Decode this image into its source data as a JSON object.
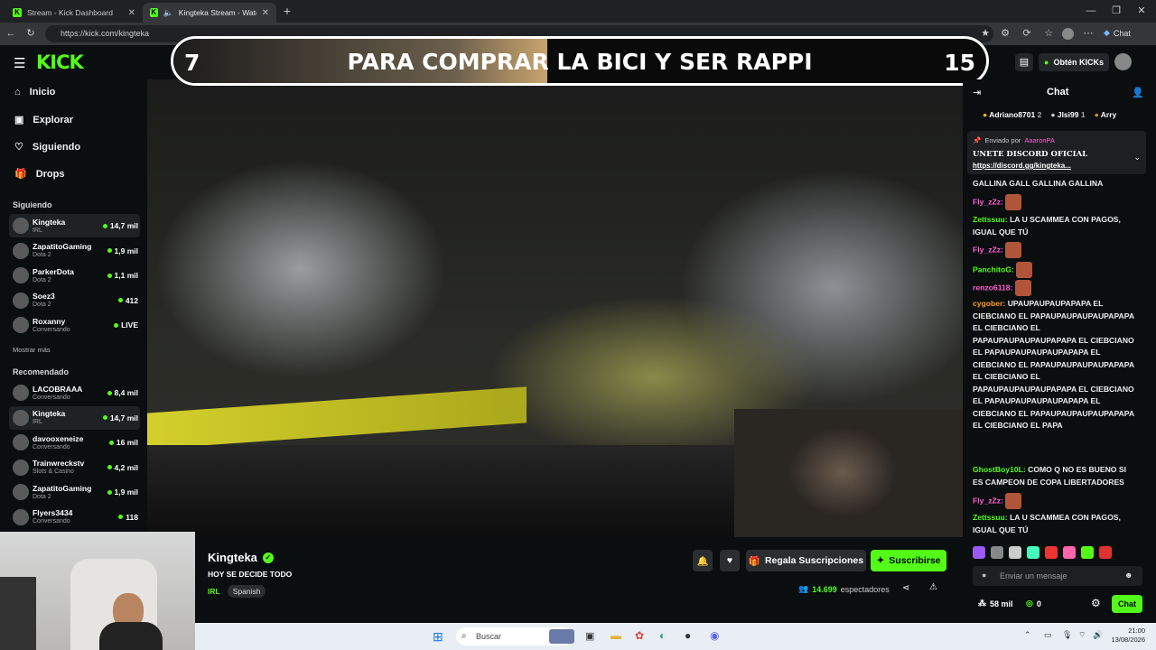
{
  "browser": {
    "tabs": [
      {
        "title": "Stream - Kick Dashboard",
        "active": false
      },
      {
        "title": "Kingteka Stream - Watch Live",
        "active": true
      }
    ],
    "url": "https://kick.com/kingteka",
    "toolbar_chat_label": "Chat"
  },
  "site": {
    "logo": "KICK",
    "get_kicks": "Obtén KICKs"
  },
  "nav": {
    "items": [
      {
        "label": "Inicio",
        "icon": "home-icon"
      },
      {
        "label": "Explorar",
        "icon": "browse-icon"
      },
      {
        "label": "Siguiendo",
        "icon": "heart-icon"
      },
      {
        "label": "Drops",
        "icon": "drops-icon"
      }
    ]
  },
  "following": {
    "title": "Siguiendo",
    "channels": [
      {
        "name": "Kingteka",
        "category": "IRL",
        "viewers": "14,7 mil"
      },
      {
        "name": "ZapatitoGaming",
        "category": "Dota 2",
        "viewers": "1,9 mil"
      },
      {
        "name": "ParkerDota",
        "category": "Dota 2",
        "viewers": "1,1 mil"
      },
      {
        "name": "Soez3",
        "category": "Dota 2",
        "viewers": "412"
      },
      {
        "name": "Roxanny",
        "category": "Conversando",
        "viewers": "LIVE"
      }
    ],
    "show_more": "Mostrar más"
  },
  "recommended": {
    "title": "Recomendado",
    "channels": [
      {
        "name": "LACOBRAAA",
        "category": "Conversando",
        "viewers": "8,4 mil"
      },
      {
        "name": "Kingteka",
        "category": "IRL",
        "viewers": "14,7 mil"
      },
      {
        "name": "davooxeneize",
        "category": "Conversando",
        "viewers": "16 mil"
      },
      {
        "name": "Trainwreckstv",
        "category": "Slots & Casino",
        "viewers": "4,2 mil"
      },
      {
        "name": "ZapatitoGaming",
        "category": "Dota 2",
        "viewers": "1,9 mil"
      },
      {
        "name": "Flyers3434",
        "category": "Conversando",
        "viewers": "118"
      }
    ]
  },
  "banner": {
    "left": "7",
    "text": "PARA COMPRAR LA BICI Y SER RAPPI",
    "right": "15",
    "progress": 0.46
  },
  "stream": {
    "channel": "Kingteka",
    "title": "HOY SE DECIDE TODO",
    "category": "IRL",
    "tag": "Spanish",
    "gift_label": "Regala Suscripciones",
    "subscribe_label": "Suscribirse",
    "viewers": "14.699",
    "viewers_label": "espectadores"
  },
  "chat": {
    "title": "Chat",
    "leaders": [
      {
        "name": "Adriano8701",
        "count": "2"
      },
      {
        "name": "Jlsi99",
        "count": "1"
      },
      {
        "name": "Arry",
        "count": ""
      }
    ],
    "pinned": {
      "sent_by": "Enviado por",
      "user": "AaaronPA",
      "line1": "UNETE DISCORD OFICIAL",
      "line2": "https://discord.gg/kingteka..."
    },
    "messages": [
      {
        "user": "",
        "text": "GALLINA GALL GALLINA GALLINA",
        "color": "#ffffff"
      },
      {
        "user": "Fly_zZz:",
        "text": "",
        "color": "#ff5fd2"
      },
      {
        "user": "Zettssuu:",
        "text": "LA U SCAMMEA CON PAGOS, IGUAL QUE TÚ",
        "color": "#53fc18"
      },
      {
        "user": "Fly_zZz:",
        "text": "",
        "color": "#ff5fd2"
      },
      {
        "user": "PanchitoG:",
        "text": "",
        "color": "#53fc18"
      },
      {
        "user": "renzo6118:",
        "text": "",
        "color": "#ff5fd2"
      },
      {
        "user": "cygober:",
        "text": "UPAUPAUPAUPAPAPA EL CIEBCIANO EL PAPAUPAUPAUPAUPAPAPA EL CIEBCIANO EL PAPAUPAUPAUPAUPAPAPA EL CIEBCIANO EL PAPAUPAUPAUPAUPAPAPA EL CIEBCIANO EL PAPAUPAUPAUPAUPAPAPA EL CIEBCIANO EL PAPAUPAUPAUPAUPAPAPA EL CIEBCIANO EL PAPAUPAUPAUPAUPAPAPA EL CIEBCIANO EL PAPAUPAUPAUPAUPAPAPA EL CIEBCIANO EL PAPA",
        "color": "#ff9a1f"
      },
      {
        "user": "GhostBoy10L:",
        "text": "COMO Q NO ES BUENO SI ES CAMPEON DE COPA LIBERTADORES",
        "color": "#53fc18"
      },
      {
        "user": "Fly_zZz:",
        "text": "",
        "color": "#ff5fd2"
      },
      {
        "user": "Zettssuu:",
        "text": "LA U SCAMMEA CON PAGOS, IGUAL QUE TÚ",
        "color": "#53fc18"
      }
    ],
    "input_placeholder": "Enviar un mensaje",
    "points": "58 mil",
    "kicks": "0",
    "send_label": "Chat"
  },
  "taskbar": {
    "search": "Buscar",
    "time": "21:00",
    "date": "13/08/2026"
  },
  "colors": {
    "accent": "#53fc18",
    "background": "#0b0e0f"
  }
}
